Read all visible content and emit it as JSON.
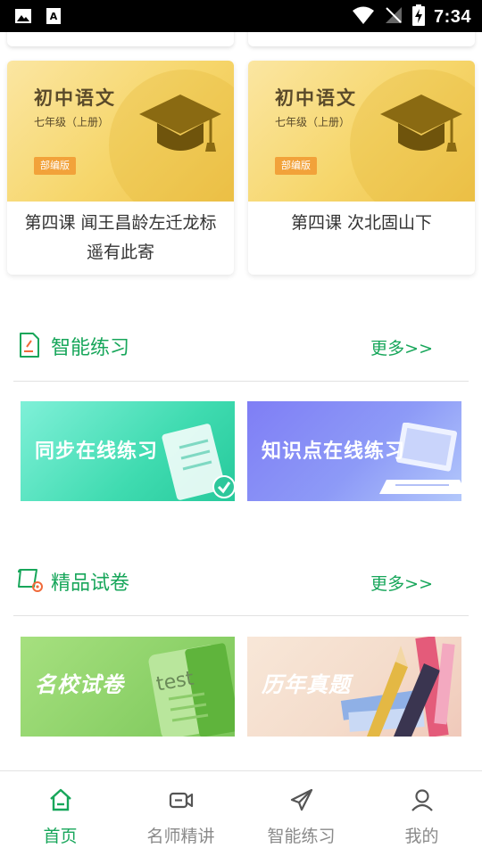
{
  "status_bar": {
    "time": "7:34"
  },
  "courses": [
    {
      "subject": "初中语文",
      "grade": "七年级（上册）",
      "edition": "部编版",
      "title": "第四课 闻王昌龄左迁龙标遥有此寄"
    },
    {
      "subject": "初中语文",
      "grade": "七年级（上册）",
      "edition": "部编版",
      "title": "第四课 次北固山下"
    }
  ],
  "practice_section": {
    "title": "智能练习",
    "more": "更多>>",
    "banners": [
      {
        "label": "同步在线练习"
      },
      {
        "label": "知识点在线练习"
      }
    ]
  },
  "exam_section": {
    "title": "精品试卷",
    "more": "更多>>",
    "banners": [
      {
        "label": "名校试卷",
        "badge": "test"
      },
      {
        "label": "历年真题"
      }
    ]
  },
  "bottom_nav": {
    "items": [
      {
        "label": "首页",
        "active": true
      },
      {
        "label": "名师精讲",
        "active": false
      },
      {
        "label": "智能练习",
        "active": false
      },
      {
        "label": "我的",
        "active": false
      }
    ]
  },
  "colors": {
    "accent": "#17a65a",
    "edition_badge": "#f2a23a"
  }
}
